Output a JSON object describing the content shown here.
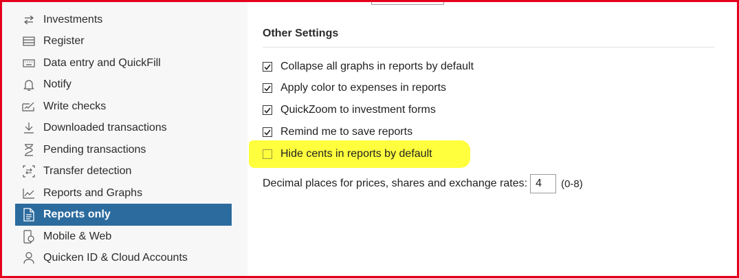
{
  "sidebar": {
    "items": [
      {
        "label": "Investments",
        "icon": "arrows-swap-icon"
      },
      {
        "label": "Register",
        "icon": "register-icon"
      },
      {
        "label": "Data entry and QuickFill",
        "icon": "keyboard-icon"
      },
      {
        "label": "Notify",
        "icon": "bell-icon"
      },
      {
        "label": "Write checks",
        "icon": "check-write-icon"
      },
      {
        "label": "Downloaded transactions",
        "icon": "download-icon"
      },
      {
        "label": "Pending transactions",
        "icon": "hourglass-icon"
      },
      {
        "label": "Transfer detection",
        "icon": "transfer-icon"
      },
      {
        "label": "Reports and Graphs",
        "icon": "chart-icon"
      },
      {
        "label": "Reports only",
        "icon": "document-icon"
      },
      {
        "label": "Mobile & Web",
        "icon": "mobile-icon"
      },
      {
        "label": "Quicken ID & Cloud Accounts",
        "icon": "user-icon"
      }
    ],
    "active_index": 9
  },
  "content": {
    "section_title": "Other Settings",
    "options": [
      {
        "label": "Collapse all graphs in reports by default",
        "checked": true
      },
      {
        "label": "Apply color to expenses in reports",
        "checked": true
      },
      {
        "label": "QuickZoom to investment forms",
        "checked": true
      },
      {
        "label": "Remind me to save reports",
        "checked": true
      },
      {
        "label": "Hide cents in reports by default",
        "checked": false
      }
    ],
    "decimal": {
      "label": "Decimal places for prices, shares and exchange rates:",
      "value": "4",
      "range": "(0-8)"
    }
  },
  "colors": {
    "active_bg": "#2c6b9e",
    "highlight": "#ffff33",
    "frame": "#e4001b"
  }
}
